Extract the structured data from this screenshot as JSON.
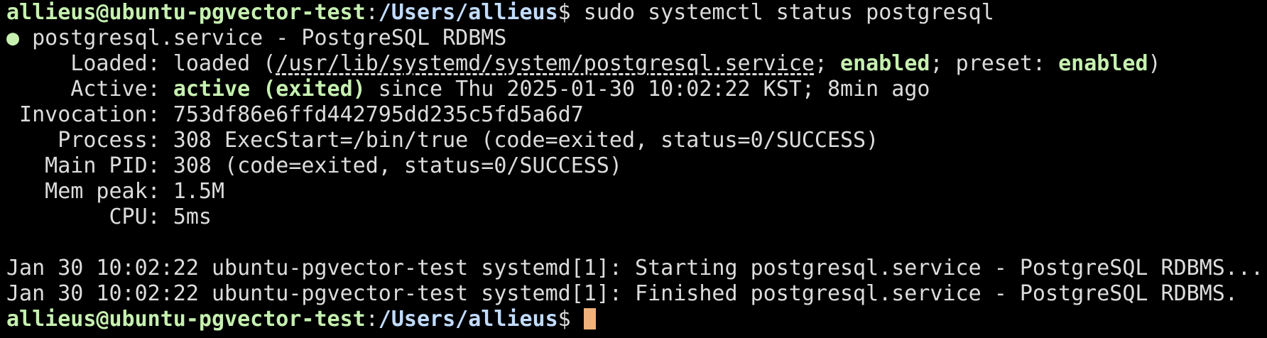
{
  "prompt": {
    "user_host": "allieus@ubuntu-pgvector-test",
    "sep": ":",
    "path": "/Users/allieus",
    "dollar": "$ ",
    "command": "sudo systemctl status postgresql"
  },
  "status": {
    "dot": "●",
    "header": " postgresql.service - PostgreSQL RDBMS",
    "loaded_label": "     Loaded: ",
    "loaded_state": "loaded (",
    "loaded_path": "/usr/lib/systemd/system/postgresql.service",
    "loaded_semi": "; ",
    "enabled1": "enabled",
    "preset_text": "; preset: ",
    "enabled2": "enabled",
    "close_paren": ")",
    "active_label": "     Active: ",
    "active_state": "active (exited)",
    "active_since": " since Thu 2025-01-30 10:02:22 KST; 8min ago",
    "invocation": " Invocation: 753df86e6ffd442795dd235c5fd5a6d7",
    "process": "    Process: 308 ExecStart=/bin/true (code=exited, status=0/SUCCESS)",
    "main_pid": "   Main PID: 308 (code=exited, status=0/SUCCESS)",
    "mem_peak": "   Mem peak: 1.5M",
    "cpu": "        CPU: 5ms"
  },
  "logs": [
    "Jan 30 10:02:22 ubuntu-pgvector-test systemd[1]: Starting postgresql.service - PostgreSQL RDBMS...",
    "Jan 30 10:02:22 ubuntu-pgvector-test systemd[1]: Finished postgresql.service - PostgreSQL RDBMS."
  ],
  "prompt2": {
    "user_host": "allieus@ubuntu-pgvector-test",
    "sep": ":",
    "path": "/Users/allieus",
    "dollar": "$ "
  },
  "colors": {
    "background": "#000000",
    "text": "#dcdcdc",
    "user_green": "#c6f0b0",
    "path_blue": "#c2dcff",
    "cursor": "#f0b27a"
  }
}
